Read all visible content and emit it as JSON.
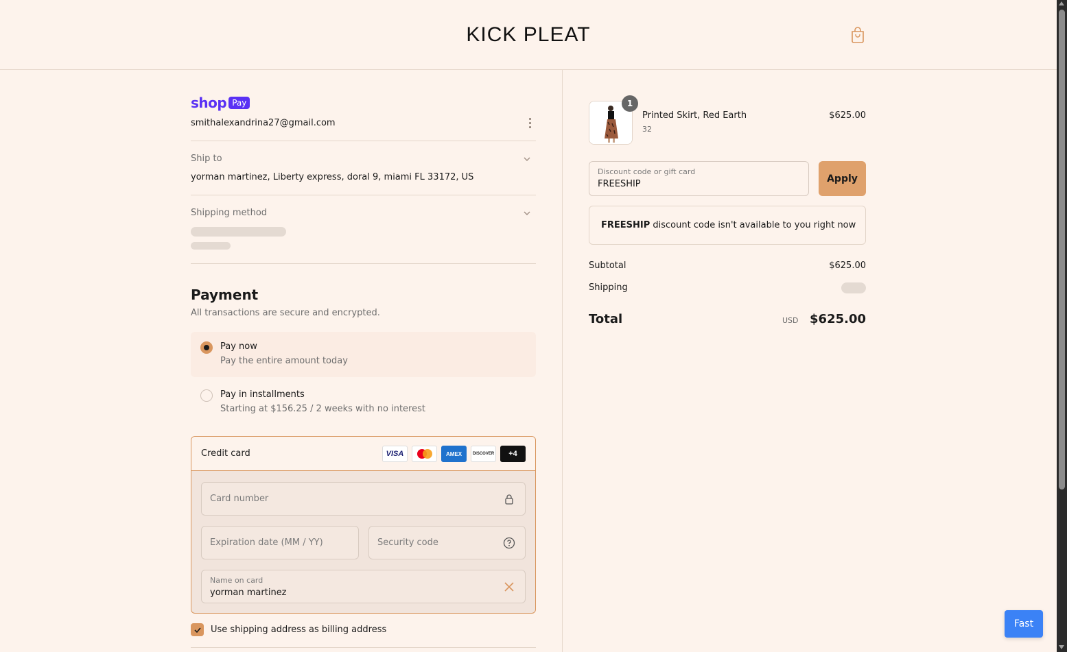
{
  "header": {
    "brand": "KICK PLEAT",
    "cart_icon": "shopping-bag-icon"
  },
  "account": {
    "shop_label": "shop",
    "pay_label": "Pay",
    "email": "smithalexandrina27@gmail.com"
  },
  "ship_to": {
    "label": "Ship to",
    "value": "yorman martinez, Liberty express, doral 9, miami FL 33172, US"
  },
  "shipping_method": {
    "label": "Shipping method"
  },
  "payment": {
    "title": "Payment",
    "subtitle": "All transactions are secure and encrypted.",
    "options": [
      {
        "title": "Pay now",
        "subtitle": "Pay the entire amount today",
        "selected": true
      },
      {
        "title": "Pay in installments",
        "subtitle": "Starting at $156.25 / 2 weeks with no interest",
        "selected": false
      }
    ],
    "credit_card": {
      "title": "Credit card",
      "logos": [
        "VISA",
        "",
        "AMEX",
        "DISCOVER",
        "+4"
      ],
      "card_number_placeholder": "Card number",
      "expiration_placeholder": "Expiration date (MM / YY)",
      "security_placeholder": "Security code",
      "name_label": "Name on card",
      "name_value": "yorman martinez"
    },
    "billing_checkbox_label": "Use shipping address as billing address",
    "billing_checked": true
  },
  "order": {
    "item": {
      "name": "Printed Skirt, Red Earth",
      "variant": "32",
      "price": "$625.00",
      "quantity": "1"
    },
    "discount": {
      "label": "Discount code or gift card",
      "value": "FREESHIP",
      "apply_label": "Apply"
    },
    "alert": {
      "code": "FREESHIP",
      "message": " discount code isn't available to you right now"
    },
    "subtotal_label": "Subtotal",
    "subtotal_value": "$625.00",
    "shipping_label": "Shipping",
    "total_label": "Total",
    "currency": "USD",
    "total_value": "$625.00"
  },
  "fast_button": "Fast",
  "colors": {
    "accent": "#dfa16c",
    "background": "#fdf3ec",
    "shop_pay": "#5a31f4",
    "fast": "#3b82f6"
  }
}
